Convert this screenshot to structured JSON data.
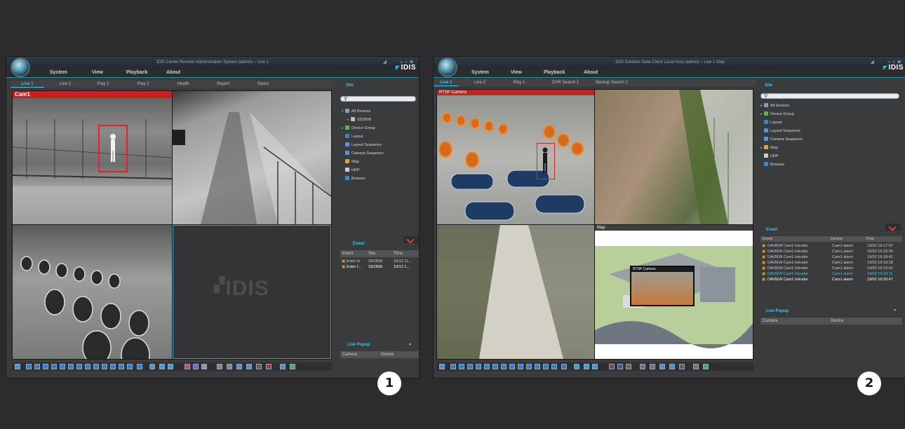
{
  "screen1": {
    "window_title": "IDIS Center Remote Administration System (admin) – Live 1",
    "menu": [
      "System",
      "View",
      "Playback",
      "About"
    ],
    "brand": "IDIS",
    "tabs": [
      "Live 1",
      "Live 2",
      "Play 1",
      "Play 2",
      "Health",
      "Report",
      "Status"
    ],
    "camera_label": "Cam1",
    "empty_tile_logo": "IDIS",
    "site_title": "Site",
    "site_tree": [
      {
        "label": "All Devices",
        "icon": "devices-icon",
        "color": "#7fa0b5",
        "indent": 0,
        "arrow": "▾"
      },
      {
        "label": "SD2808",
        "icon": "nvr-icon",
        "color": "#b7c0c6",
        "indent": 1,
        "arrow": "▸"
      },
      {
        "label": "Device Group",
        "icon": "device-group-icon",
        "color": "#4bbd4b",
        "indent": 0,
        "arrow": "▸"
      },
      {
        "label": "Layout",
        "icon": "layout-icon",
        "color": "#3d7ed6",
        "indent": 0,
        "arrow": ""
      },
      {
        "label": "Layout Sequence",
        "icon": "layout-sequence-icon",
        "color": "#5a92dd",
        "indent": 0,
        "arrow": ""
      },
      {
        "label": "Camera Sequence",
        "icon": "camera-sequence-icon",
        "color": "#5a92dd",
        "indent": 0,
        "arrow": ""
      },
      {
        "label": "Map",
        "icon": "map-icon",
        "color": "#e0a33a",
        "indent": 0,
        "arrow": ""
      },
      {
        "label": "HDP",
        "icon": "hdp-icon",
        "color": "#c9ced2",
        "indent": 0,
        "arrow": ""
      },
      {
        "label": "Browser",
        "icon": "browser-icon",
        "color": "#2f8fd8",
        "indent": 0,
        "arrow": ""
      }
    ],
    "event_title": "Event",
    "event_columns": [
      "Event",
      "Site",
      "Time"
    ],
    "event_rows": [
      {
        "event": "Enter In",
        "site": "SD2808",
        "time": "19/12 11...",
        "color": "#c9ced2"
      },
      {
        "event": "Enter I...",
        "site": "SD2808",
        "time": "19/12 1...",
        "color": "#ffffff"
      }
    ],
    "live_popup_title": "Live Popup",
    "live_popup_columns": [
      "Camera",
      "Device"
    ],
    "badge": "1"
  },
  "screen2": {
    "window_title": "IDIS Solution Suite Client Local Host (admin) – Live 1 Map",
    "menu": [
      "System",
      "View",
      "Playback",
      "About"
    ],
    "brand": "IDIS",
    "tabs": [
      "Live 1",
      "Live 2",
      "Play 1",
      "DVR Search 1",
      "Backup Search 1"
    ],
    "camera_label": "RTSP Camera",
    "map_label": "Map",
    "map_popup_label": "RTSP Camera",
    "site_title": "Site",
    "site_tree": [
      {
        "label": "All Devices",
        "icon": "devices-icon",
        "color": "#7fa0b5",
        "indent": 0,
        "arrow": "▸"
      },
      {
        "label": "Device Group",
        "icon": "device-group-icon",
        "color": "#4bbd4b",
        "indent": 0,
        "arrow": "▸"
      },
      {
        "label": "Layout",
        "icon": "layout-icon",
        "color": "#3d7ed6",
        "indent": 0,
        "arrow": ""
      },
      {
        "label": "Layout Sequence",
        "icon": "layout-sequence-icon",
        "color": "#5a92dd",
        "indent": 0,
        "arrow": ""
      },
      {
        "label": "Camera Sequence",
        "icon": "camera-sequence-icon",
        "color": "#5a92dd",
        "indent": 0,
        "arrow": ""
      },
      {
        "label": "Map",
        "icon": "map-icon",
        "color": "#e0a33a",
        "indent": 0,
        "arrow": "▸"
      },
      {
        "label": "HDP",
        "icon": "hdp-icon",
        "color": "#c9ced2",
        "indent": 0,
        "arrow": ""
      },
      {
        "label": "Browser",
        "icon": "browser-icon",
        "color": "#2f8fd8",
        "indent": 0,
        "arrow": ""
      }
    ],
    "event_title": "Event",
    "event_columns": [
      "Event",
      "Device",
      "Time"
    ],
    "event_rows": [
      {
        "event": "DAVIEW Cam1 Intruder",
        "device": "Cam1 alarm",
        "time": "19/02 16:17:07",
        "color": "#c9ced2"
      },
      {
        "event": "DAVIEW Cam1 Intruder",
        "device": "Cam1 alarm",
        "time": "19/02 16:18:09",
        "color": "#c9ced2"
      },
      {
        "event": "DAVIEW Cam1 Intruder",
        "device": "Cam1 alarm",
        "time": "19/02 16:18:42",
        "color": "#c9ced2"
      },
      {
        "event": "DAVIEW Cam1 Intruder",
        "device": "Cam1 alarm",
        "time": "19/02 16:19:18",
        "color": "#c9ced2"
      },
      {
        "event": "DAVIEW Cam1 Intruder",
        "device": "Cam1 alarm",
        "time": "19/02 16:19:42",
        "color": "#c9ced2"
      },
      {
        "event": "DAVIEW Cam1 Intruder",
        "device": "Cam1 alarm",
        "time": "19/02 16:20:11",
        "color": "#3fc4e8"
      },
      {
        "event": "DAVIEW Cam1 Intruder",
        "device": "Cam1 alarm",
        "time": "19/02 16:20:47",
        "color": "#ffffff"
      }
    ],
    "live_popup_title": "Live Popup",
    "live_popup_columns": [
      "Camera",
      "Device"
    ],
    "badge": "2"
  },
  "colors": {
    "accent": "#3fc4e8",
    "alert": "#e2412f",
    "detection": "#e3222a"
  }
}
